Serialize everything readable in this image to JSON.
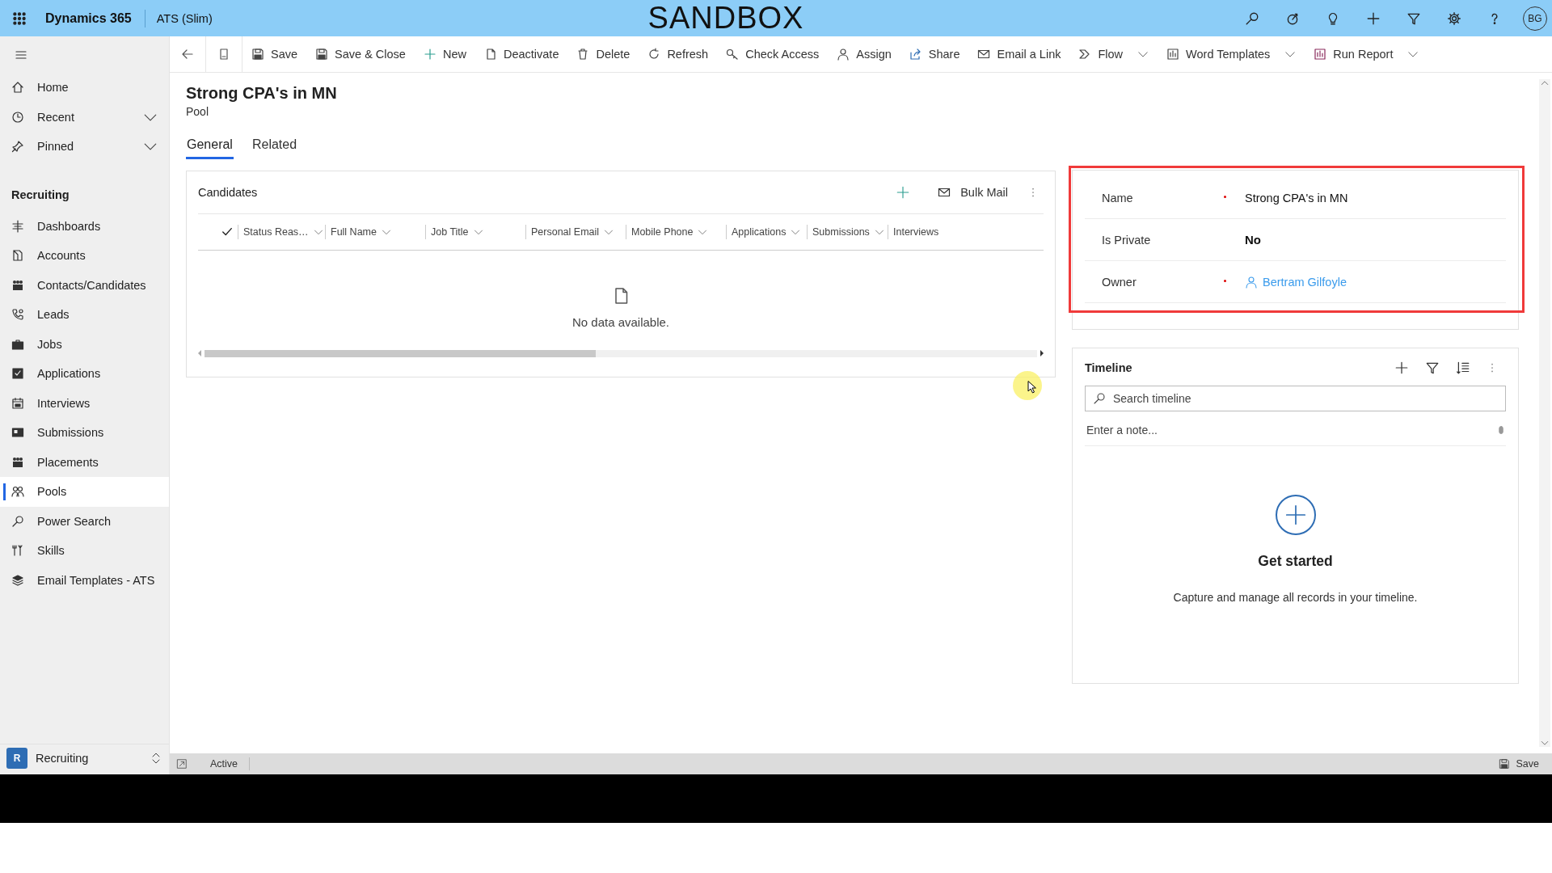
{
  "header": {
    "app_name": "Dynamics 365",
    "app_module": "ATS (Slim)",
    "environment": "SANDBOX",
    "avatar_initials": "BG"
  },
  "sidebar": {
    "top_items": [
      {
        "label": "Home",
        "kind": "link"
      },
      {
        "label": "Recent",
        "kind": "flyout",
        "expanded": false
      },
      {
        "label": "Pinned",
        "kind": "flyout",
        "expanded": false
      }
    ],
    "section_title": "Recruiting",
    "items": [
      {
        "label": "Dashboards",
        "selected": false
      },
      {
        "label": "Accounts",
        "selected": false
      },
      {
        "label": "Contacts/Candidates",
        "selected": false
      },
      {
        "label": "Leads",
        "selected": false
      },
      {
        "label": "Jobs",
        "selected": false
      },
      {
        "label": "Applications",
        "selected": false
      },
      {
        "label": "Interviews",
        "selected": false
      },
      {
        "label": "Submissions",
        "selected": false
      },
      {
        "label": "Placements",
        "selected": false
      },
      {
        "label": "Pools",
        "selected": true
      },
      {
        "label": "Power Search",
        "selected": false
      },
      {
        "label": "Skills",
        "selected": false
      },
      {
        "label": "Email Templates - ATS",
        "selected": false
      }
    ],
    "area_switcher": {
      "badge": "R",
      "label": "Recruiting"
    }
  },
  "command_bar": {
    "commands": [
      {
        "label": "Save",
        "has_menu": false
      },
      {
        "label": "Save & Close",
        "has_menu": false
      },
      {
        "label": "New",
        "has_menu": false
      },
      {
        "label": "Deactivate",
        "has_menu": false
      },
      {
        "label": "Delete",
        "has_menu": false
      },
      {
        "label": "Refresh",
        "has_menu": false
      },
      {
        "label": "Check Access",
        "has_menu": false
      },
      {
        "label": "Assign",
        "has_menu": false
      },
      {
        "label": "Share",
        "has_menu": false
      },
      {
        "label": "Email a Link",
        "has_menu": false
      },
      {
        "label": "Flow",
        "has_menu": true
      },
      {
        "label": "Word Templates",
        "has_menu": true
      },
      {
        "label": "Run Report",
        "has_menu": true
      }
    ]
  },
  "record": {
    "title": "Strong CPA's in MN",
    "entity": "Pool",
    "tabs": [
      {
        "label": "General",
        "selected": true
      },
      {
        "label": "Related",
        "selected": false
      }
    ]
  },
  "candidates_grid": {
    "title": "Candidates",
    "bulk_action": "Bulk Mail",
    "columns": [
      {
        "label": "Status Reas…",
        "has_menu": true
      },
      {
        "label": "Full Name",
        "has_menu": true
      },
      {
        "label": "Job Title",
        "has_menu": true
      },
      {
        "label": "Personal Email",
        "has_menu": true
      },
      {
        "label": "Mobile Phone",
        "has_menu": true
      },
      {
        "label": "Applications",
        "has_menu": true
      },
      {
        "label": "Submissions",
        "has_menu": true
      },
      {
        "label": "Interviews",
        "has_menu": false
      }
    ],
    "empty_message": "No data available."
  },
  "summary": {
    "highlighted": true,
    "fields": [
      {
        "label": "Name",
        "required": true,
        "kind": "text",
        "value": "Strong CPA's in MN"
      },
      {
        "label": "Is Private",
        "required": false,
        "kind": "bold",
        "value": "No"
      },
      {
        "label": "Owner",
        "required": true,
        "kind": "lookup",
        "value": "Bertram Gilfoyle"
      }
    ]
  },
  "timeline": {
    "title": "Timeline",
    "search_placeholder": "Search timeline",
    "note_placeholder": "Enter a note...",
    "empty_title": "Get started",
    "empty_message": "Capture and manage all records in your timeline."
  },
  "status_bar": {
    "status": "Active",
    "save_label": "Save"
  }
}
